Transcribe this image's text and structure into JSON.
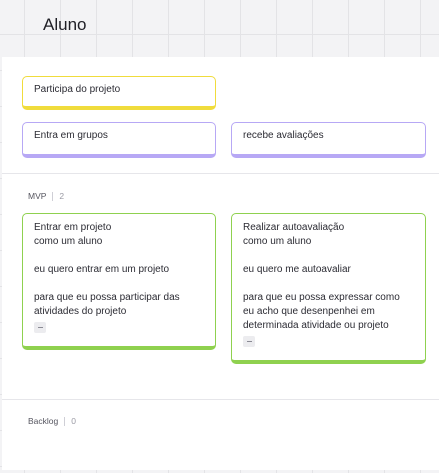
{
  "board": {
    "title": "Aluno"
  },
  "top_notes": [
    {
      "text": "Participa do projeto",
      "color": "#f0dc3c"
    },
    {
      "text": "Entra em grupos",
      "color": "#b7a8f5"
    },
    {
      "text": "recebe avaliações",
      "color": "#b7a8f5"
    }
  ],
  "sections": {
    "mvp": {
      "label": "MVP",
      "count": "2"
    },
    "backlog": {
      "label": "Backlog",
      "count": "0"
    }
  },
  "stories": [
    {
      "line1": "Entrar em projeto",
      "line2": "como um aluno",
      "line3": "eu quero entrar em um projeto",
      "line4": "para que eu possa participar das",
      "line5": "atividades do projeto",
      "line6": "",
      "icon": "notes-icon",
      "color": "#8fd14f"
    },
    {
      "line1": "Realizar autoavaliação",
      "line2": "como um aluno",
      "line3": "eu quero me autoavaliar",
      "line4": "para que eu possa expressar como",
      "line5": "eu acho que desenpenhei em",
      "line6": "determinada atividade ou projeto",
      "icon": "notes-icon",
      "color": "#8fd14f"
    }
  ]
}
